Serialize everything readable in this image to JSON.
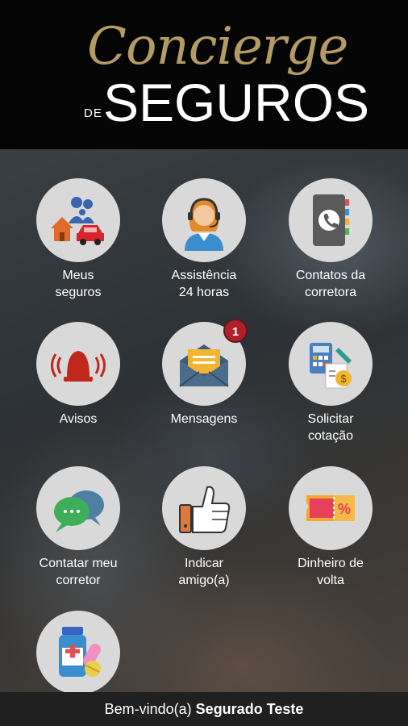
{
  "header": {
    "logo_script": "Concierge",
    "logo_de": "DE",
    "logo_main": "SEGUROS"
  },
  "menu": {
    "items": [
      {
        "label": "Meus\nseguros",
        "icon": "family-house-car-icon"
      },
      {
        "label": "Assistência\n24 horas",
        "icon": "headset-agent-icon"
      },
      {
        "label": "Contatos da\ncorretora",
        "icon": "phone-book-icon"
      },
      {
        "label": "Avisos",
        "icon": "alarm-bell-icon"
      },
      {
        "label": "Mensagens",
        "icon": "envelope-icon",
        "badge": "1"
      },
      {
        "label": "Solicitar\ncotação",
        "icon": "calculator-icon"
      },
      {
        "label": "Contatar meu\ncorretor",
        "icon": "chat-bubbles-icon"
      },
      {
        "label": "Indicar\namigo(a)",
        "icon": "thumbs-up-icon"
      },
      {
        "label": "Dinheiro de\nvolta",
        "icon": "discount-coupon-icon"
      },
      {
        "label": "",
        "icon": "pills-bottle-icon"
      }
    ]
  },
  "footer": {
    "welcome": "Bem-vindo(a)",
    "user_name": "Segurado Teste"
  },
  "colors": {
    "header_bg": "#050505",
    "logo_gold": "#b49a63",
    "tile_bg": "#d9d9d9",
    "badge": "#b0202a",
    "footer_bg": "#202020"
  }
}
